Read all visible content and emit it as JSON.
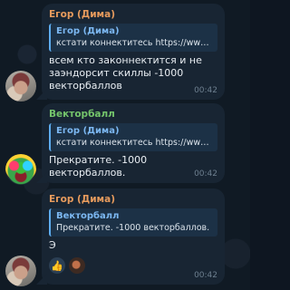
{
  "messages": [
    {
      "sender": "Егор (Дима)",
      "reply_to_name": "Егор (Дима)",
      "reply_to_text": "кстати коннектитесь https://www....",
      "text": "всем кто законнектится и не заэндорсит скиллы -1000 векторбаллов",
      "time": "00:42",
      "avatar": "egor-avatar"
    },
    {
      "sender": "Векторбалл",
      "reply_to_name": "Егор (Дима)",
      "reply_to_text": "кстати коннектитесь https://www....",
      "text": "Прекратите. -1000 векторбаллов.",
      "time": "00:42",
      "avatar": "vektorball-avatar"
    },
    {
      "sender": "Егор (Дима)",
      "reply_to_name": "Векторбалл",
      "reply_to_text": "Прекратите. -1000 векторбаллов.",
      "text": "Э",
      "time": "00:42",
      "avatar": "egor-avatar",
      "reactions": [
        "thumbs-up-icon",
        "user-reaction-avatar"
      ],
      "reaction_glyphs": [
        "👍",
        ""
      ]
    }
  ],
  "colors": {
    "background": "#101a24",
    "bubble": "#182533",
    "sender_egor": "#e79b5d",
    "sender_vektorball": "#74c46b",
    "reply_accent": "#5eadf0"
  }
}
